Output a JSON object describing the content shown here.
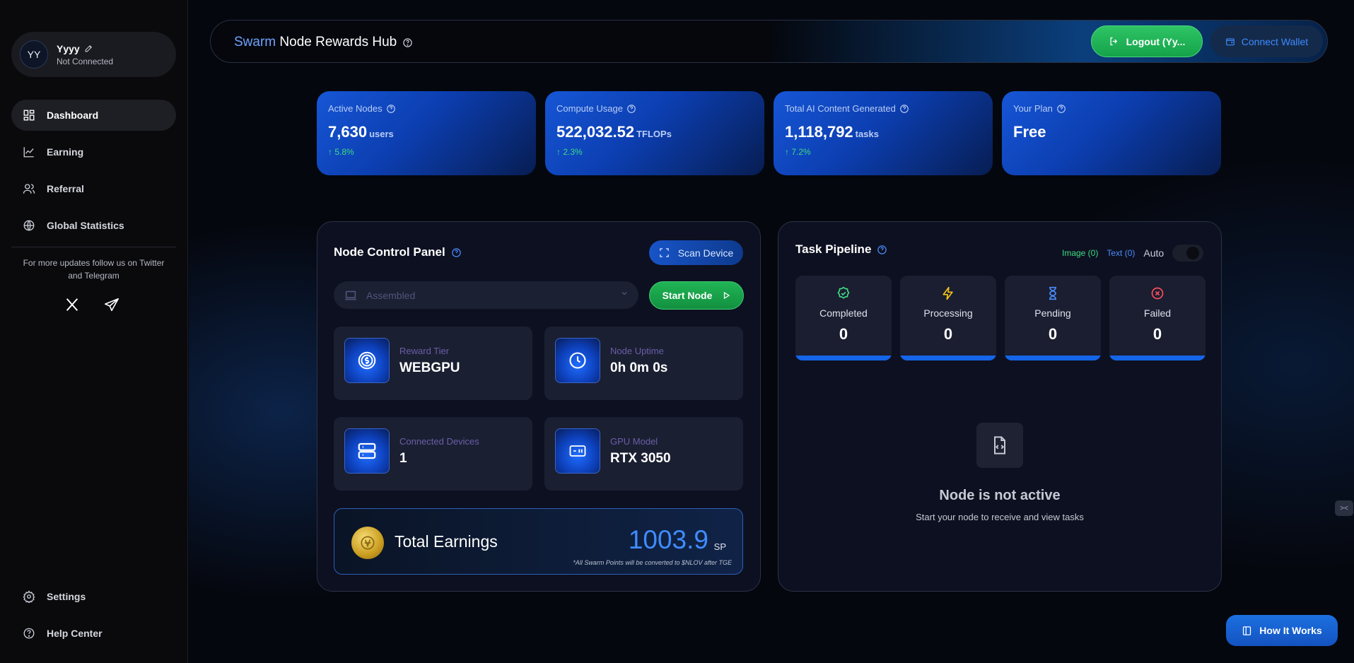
{
  "colors": {
    "accent": "#3f8cff",
    "green": "#2ec465",
    "success_text": "#3ddc84",
    "stat_blue": "#1656d6"
  },
  "sidebar": {
    "profile": {
      "initials": "YY",
      "name": "Yyyy",
      "status": "Not Connected"
    },
    "items": [
      {
        "label": "Dashboard",
        "icon": "dashboard-icon",
        "active": true
      },
      {
        "label": "Earning",
        "icon": "chart-line-icon"
      },
      {
        "label": "Referral",
        "icon": "users-icon"
      },
      {
        "label": "Global Statistics",
        "icon": "globe-icon"
      }
    ],
    "follow_text": "For more updates follow us on Twitter and Telegram",
    "bottom_items": [
      {
        "label": "Settings",
        "icon": "gear-icon"
      },
      {
        "label": "Help Center",
        "icon": "help-icon"
      }
    ]
  },
  "header": {
    "title_accent": "Swarm",
    "title_rest": "Node Rewards Hub",
    "logout_label": "Logout (Yy...",
    "wallet_label": "Connect Wallet"
  },
  "stats": [
    {
      "label": "Active Nodes",
      "value": "7,630",
      "unit": "users",
      "change": "↑ 5.8%"
    },
    {
      "label": "Compute Usage",
      "value": "522,032.52",
      "unit": "TFLOPs",
      "change": "↑ 2.3%"
    },
    {
      "label": "Total AI Content Generated",
      "value": "1,118,792",
      "unit": "tasks",
      "change": "↑ 7.2%"
    },
    {
      "label": "Your Plan",
      "value": "Free"
    }
  ],
  "control_panel": {
    "title": "Node Control Panel",
    "scan_label": "Scan Device",
    "device_placeholder": "Assembled",
    "start_label": "Start Node",
    "cards": [
      {
        "label": "Reward Tier",
        "value": "WEBGPU",
        "icon": "coin-dollar-icon"
      },
      {
        "label": "Node Uptime",
        "value": "0h 0m 0s",
        "icon": "clock-icon"
      },
      {
        "label": "Connected Devices",
        "value": "1",
        "icon": "server-icon"
      },
      {
        "label": "GPU Model",
        "value": "RTX 3050",
        "icon": "gpu-icon"
      }
    ],
    "earnings": {
      "label": "Total Earnings",
      "value": "1003.9",
      "unit": "SP",
      "note": "*All Swarm Points will be converted to $NLOV after TGE"
    }
  },
  "pipeline": {
    "title": "Task Pipeline",
    "filter_image": "Image (0)",
    "filter_text": "Text (0)",
    "auto_label": "Auto",
    "tasks": [
      {
        "label": "Completed",
        "value": "0",
        "icon": "check-badge-icon",
        "color": "#3ddc84"
      },
      {
        "label": "Processing",
        "value": "0",
        "icon": "lightning-icon",
        "color": "#f5c518"
      },
      {
        "label": "Pending",
        "value": "0",
        "icon": "hourglass-icon",
        "color": "#4a8cff"
      },
      {
        "label": "Failed",
        "value": "0",
        "icon": "x-circle-icon",
        "color": "#ff4d5e"
      }
    ],
    "empty_title": "Node is not active",
    "empty_subtitle": "Start your node to receive and view tasks"
  },
  "how_it_works_label": "How It Works"
}
